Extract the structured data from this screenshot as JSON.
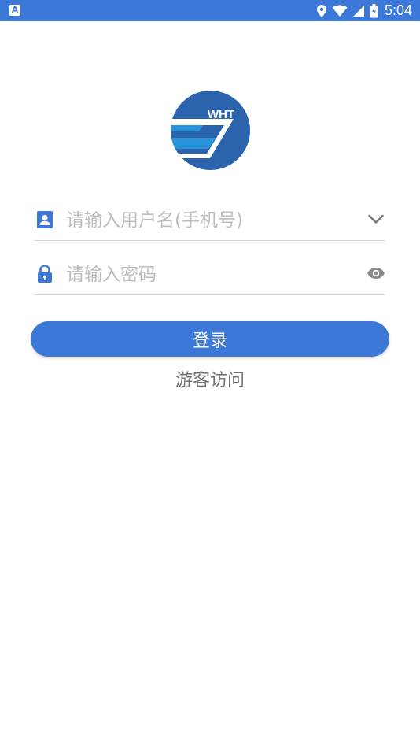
{
  "status_bar": {
    "left_icon": "A",
    "time": "5:04",
    "icons": [
      "location-icon",
      "wifi-icon",
      "signal-icon",
      "battery-charging-icon"
    ]
  },
  "logo": {
    "text": "WHT",
    "colors": {
      "circle": "#2b63ad",
      "stripe": "#2793d8",
      "white": "#ffffff"
    }
  },
  "username": {
    "placeholder": "请输入用户名(手机号)",
    "icon": "contact-card-icon",
    "trailing_icon": "chevron-down-icon"
  },
  "password": {
    "placeholder": "请输入密码",
    "icon": "lock-icon",
    "trailing_icon": "eye-icon"
  },
  "login_button": {
    "label": "登录"
  },
  "guest_link": {
    "label": "游客访问"
  },
  "colors": {
    "accent": "#3b78d8",
    "placeholder": "#bdbdbd",
    "divider": "#d6d6d6",
    "link": "#757575"
  }
}
